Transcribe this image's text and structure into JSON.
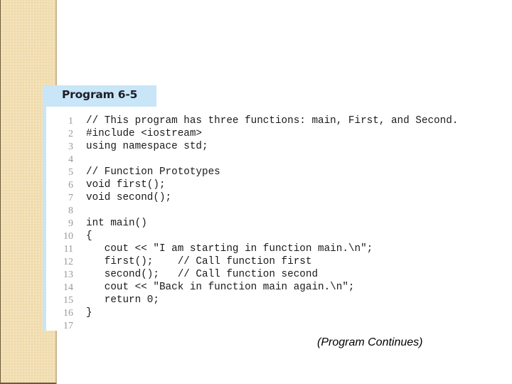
{
  "slide": {
    "program_title": "Program 6-5",
    "continues_label": "(Program Continues)",
    "colors": {
      "sidebar": "#f0dcae",
      "header_accent": "#c8e6f7",
      "line_number": "#9a9a9a",
      "code_text": "#1a1a1a"
    },
    "code_lines": [
      {
        "num": "1",
        "code": "// This program has three functions: main, First, and Second."
      },
      {
        "num": "2",
        "code": "#include <iostream>"
      },
      {
        "num": "3",
        "code": "using namespace std;"
      },
      {
        "num": "4",
        "code": ""
      },
      {
        "num": "5",
        "code": "// Function Prototypes"
      },
      {
        "num": "6",
        "code": "void first();"
      },
      {
        "num": "7",
        "code": "void second();"
      },
      {
        "num": "8",
        "code": ""
      },
      {
        "num": "9",
        "code": "int main()"
      },
      {
        "num": "10",
        "code": "{"
      },
      {
        "num": "11",
        "code": "   cout << \"I am starting in function main.\\n\";"
      },
      {
        "num": "12",
        "code": "   first();    // Call function first"
      },
      {
        "num": "13",
        "code": "   second();   // Call function second"
      },
      {
        "num": "14",
        "code": "   cout << \"Back in function main again.\\n\";"
      },
      {
        "num": "15",
        "code": "   return 0;"
      },
      {
        "num": "16",
        "code": "}"
      },
      {
        "num": "17",
        "code": ""
      }
    ]
  }
}
